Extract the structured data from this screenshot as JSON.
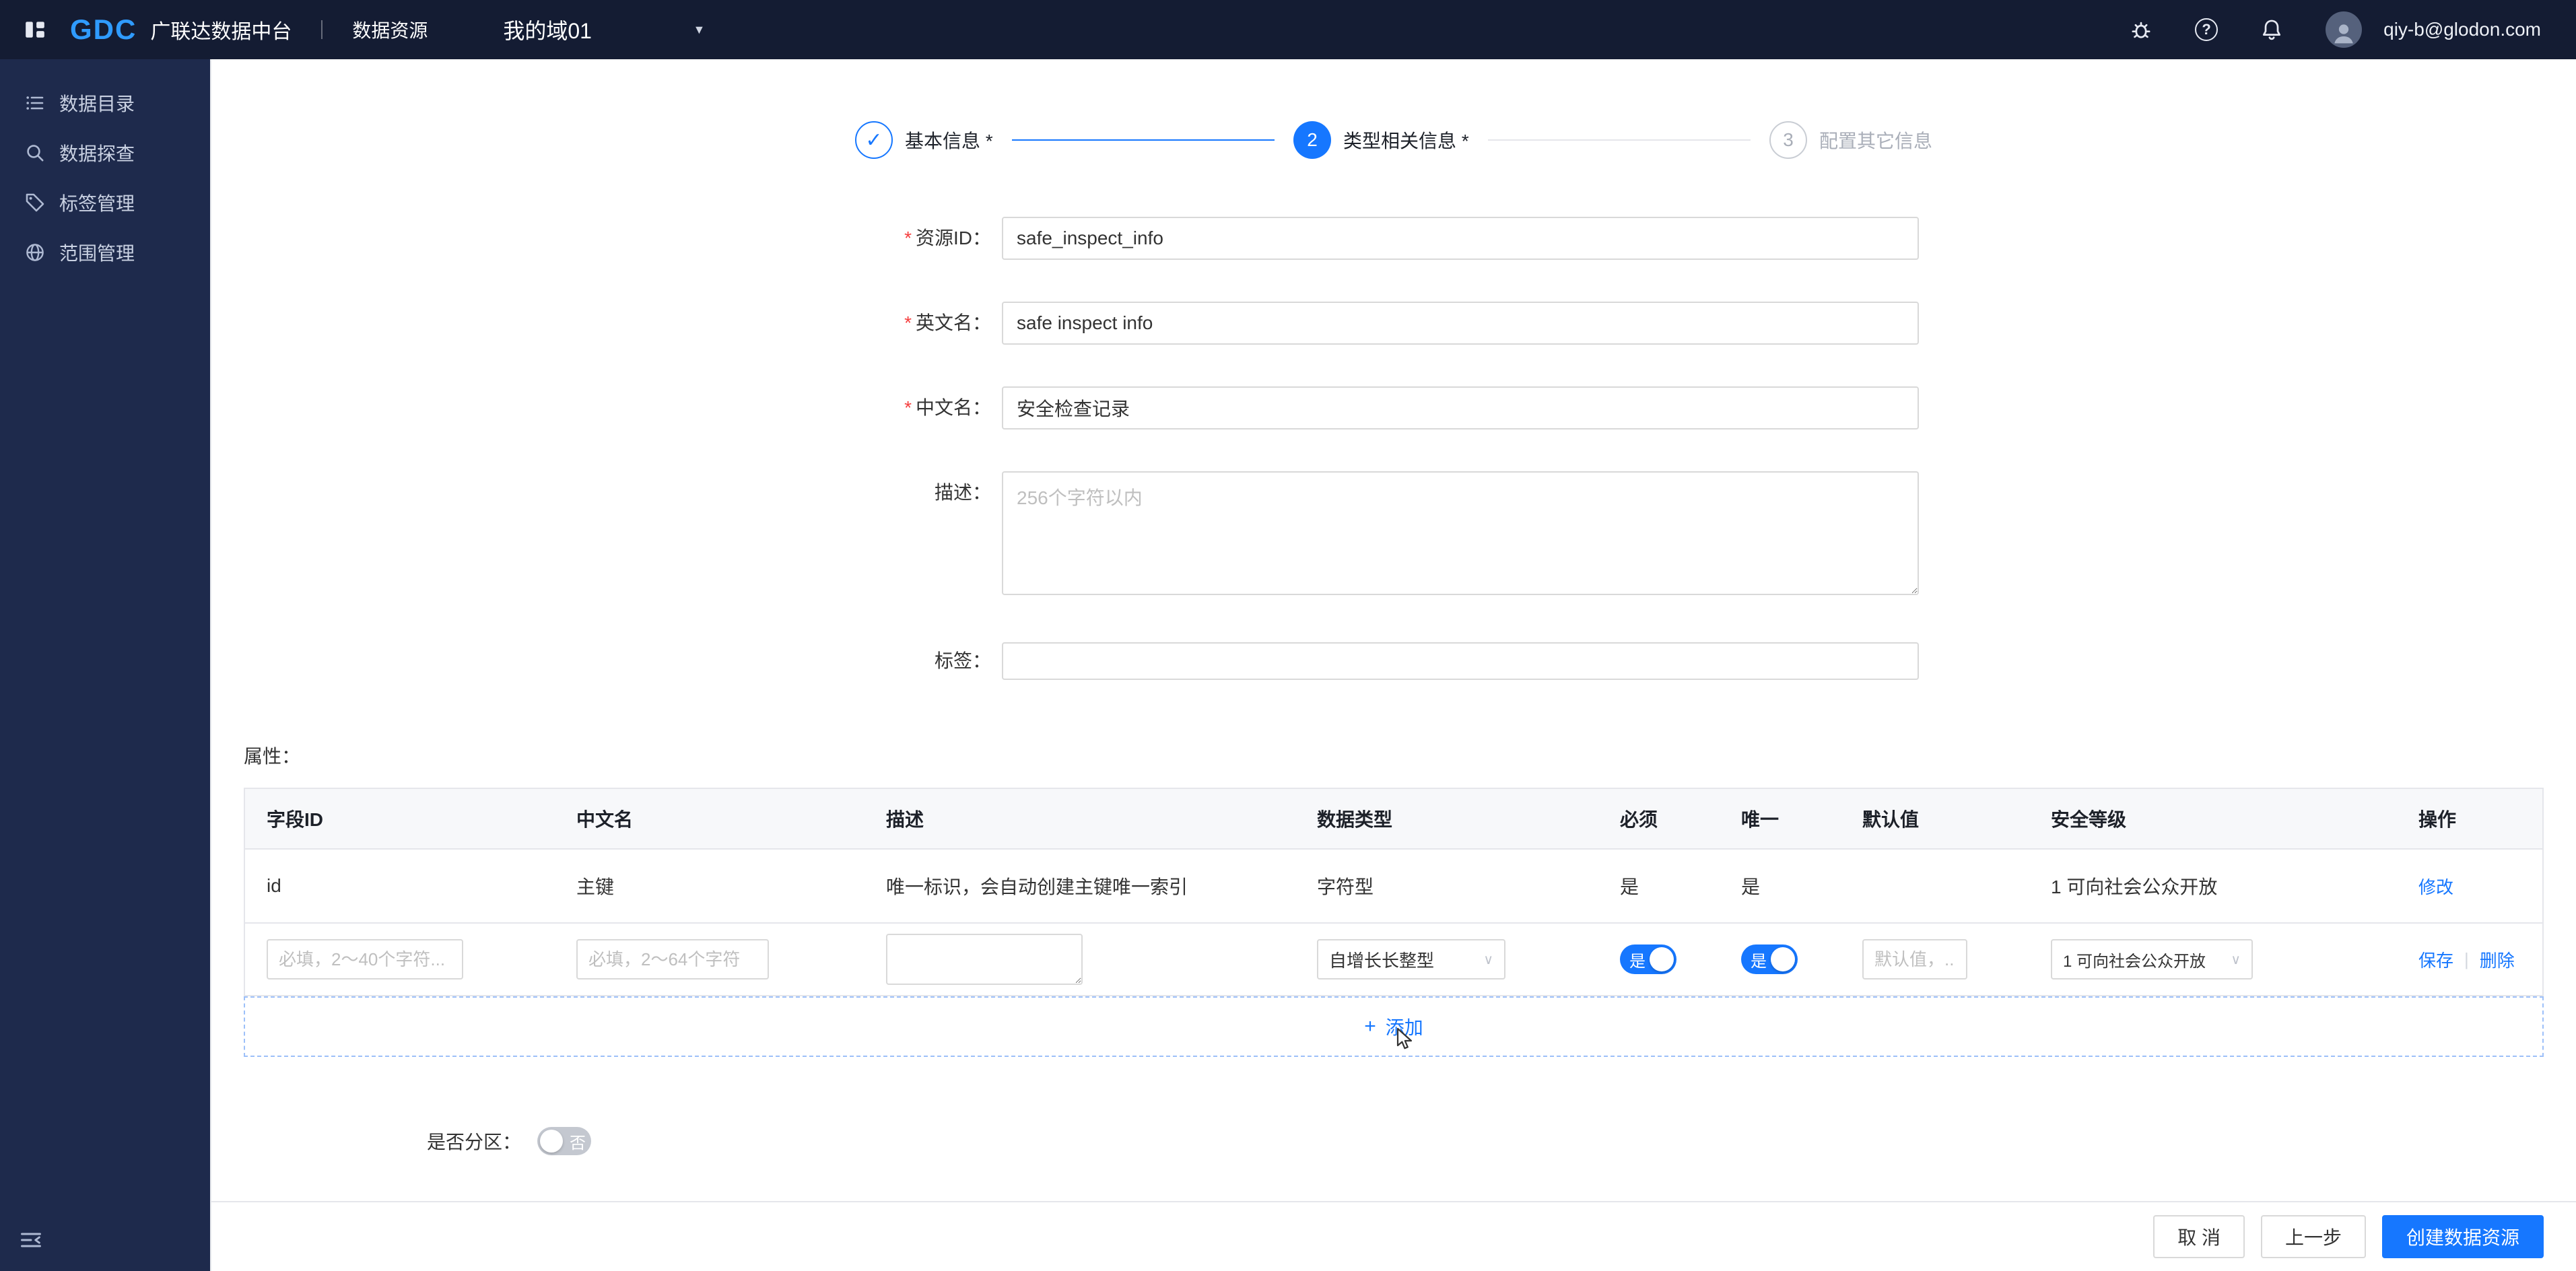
{
  "icons": {
    "caret_down": "▼",
    "check": "✓",
    "help": "?",
    "plus": "+",
    "chevron_down": "∨",
    "action_divider": "|"
  },
  "topbar": {
    "logo": "GDC",
    "brand": "广联达数据中台",
    "nav_data_resource": "数据资源",
    "domain": "我的域01",
    "email": "qiy-b@glodon.com"
  },
  "sidebar": {
    "items": [
      {
        "label": "数据目录"
      },
      {
        "label": "数据探查"
      },
      {
        "label": "标签管理"
      },
      {
        "label": "范围管理"
      }
    ]
  },
  "steps": {
    "s1": {
      "label": "基本信息 *"
    },
    "s2": {
      "num": "2",
      "label": "类型相关信息 *"
    },
    "s3": {
      "num": "3",
      "label": "配置其它信息"
    }
  },
  "form": {
    "required_mark": "*",
    "resource_id": {
      "label": "资源ID：",
      "value": "safe_inspect_info"
    },
    "en_name": {
      "label": "英文名：",
      "value": "safe inspect info"
    },
    "cn_name": {
      "label": "中文名：",
      "value": "安全检查记录"
    },
    "desc": {
      "label": "描述：",
      "placeholder": "256个字符以内"
    },
    "tag": {
      "label": "标签："
    }
  },
  "attrs": {
    "section_label": "属性：",
    "headers": [
      "字段ID",
      "中文名",
      "描述",
      "数据类型",
      "必须",
      "唯一",
      "默认值",
      "安全等级",
      "操作"
    ],
    "row1": {
      "field_id": "id",
      "cn_name": "主键",
      "desc": "唯一标识，会自动创建主键唯一索引",
      "data_type": "字符型",
      "required": "是",
      "unique": "是",
      "default_value": "",
      "security": "1 可向社会公众开放",
      "action_edit": "修改"
    },
    "edit_row": {
      "field_id_ph": "必填，2～40个字符...",
      "cn_name_ph": "必填，2～64个字符",
      "data_type": "自增长长整型",
      "required_on": "是",
      "unique_on": "是",
      "default_ph": "默认值，...",
      "security": "1 可向社会公众开放",
      "save": "保存",
      "del": "删除"
    },
    "add_label": "添加"
  },
  "partition": {
    "label": "是否分区：",
    "off_text": "否"
  },
  "footer": {
    "cancel": "取 消",
    "prev": "上一步",
    "create": "创建数据资源"
  },
  "colors": {
    "primary": "#1677ff",
    "topbar_bg": "#141c33",
    "sidebar_bg": "#1e2a4c",
    "link": "#1677ff",
    "star": "#f53f3f"
  }
}
